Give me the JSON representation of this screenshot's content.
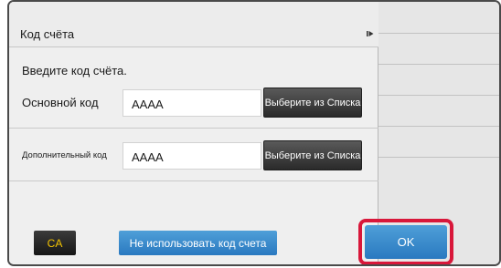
{
  "dialog": {
    "title": "Код счёта",
    "instruction": "Введите код счёта."
  },
  "main_code": {
    "label": "Основной код",
    "value": "AAAA",
    "select_label": "Выберите из Списка"
  },
  "sub_code": {
    "label": "Дополнительный код",
    "value": "AAAA",
    "select_label": "Выберите из Списка"
  },
  "footer": {
    "ca_label": "CA",
    "no_account_label": "Не использовать код счета",
    "ok_label": "OK"
  },
  "colors": {
    "accent_blue": "#2a79c0",
    "highlight_red": "#d8173a",
    "ca_text": "#f4c400"
  },
  "icons": {
    "collapse_tab": "triangle-right-icon"
  }
}
